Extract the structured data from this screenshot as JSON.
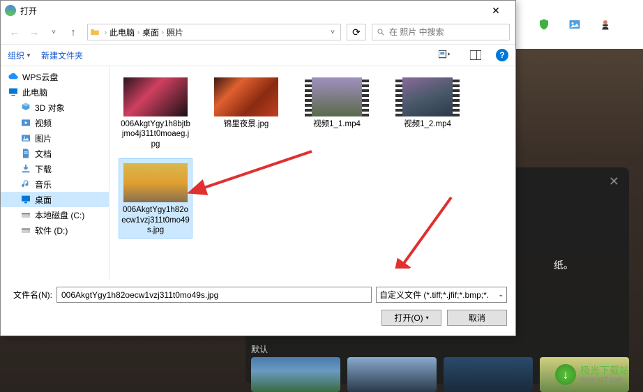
{
  "dialog": {
    "title": "打开",
    "breadcrumb": [
      "此电脑",
      "桌面",
      "照片"
    ],
    "search_placeholder": "在 照片 中搜索",
    "toolbar": {
      "organize": "组织",
      "new_folder": "新建文件夹"
    },
    "sidebar": [
      {
        "label": "WPS云盘",
        "icon": "cloud",
        "color": "#1e90ff"
      },
      {
        "label": "此电脑",
        "icon": "pc",
        "color": "#0078d7"
      },
      {
        "label": "3D 对象",
        "icon": "3d",
        "color": "#50a0e0",
        "indent": true
      },
      {
        "label": "视频",
        "icon": "video",
        "color": "#5090d0",
        "indent": true
      },
      {
        "label": "图片",
        "icon": "pictures",
        "color": "#5090d0",
        "indent": true
      },
      {
        "label": "文档",
        "icon": "docs",
        "color": "#5090d0",
        "indent": true
      },
      {
        "label": "下载",
        "icon": "downloads",
        "color": "#5090d0",
        "indent": true
      },
      {
        "label": "音乐",
        "icon": "music",
        "color": "#5090d0",
        "indent": true
      },
      {
        "label": "桌面",
        "icon": "desktop",
        "color": "#0078d7",
        "indent": true,
        "selected": true
      },
      {
        "label": "本地磁盘 (C:)",
        "icon": "drive",
        "color": "#888",
        "indent": true
      },
      {
        "label": "软件 (D:)",
        "icon": "drive",
        "color": "#888",
        "indent": true
      }
    ],
    "files": [
      {
        "name": "006AkgtYgy1h8bjtbjmo4j311t0moaeg.jpg",
        "thumb": "img1"
      },
      {
        "name": "锦里夜景.jpg",
        "thumb": "img2"
      },
      {
        "name": "视频1_1.mp4",
        "thumb": "vid3",
        "video": true
      },
      {
        "name": "视频1_2.mp4",
        "thumb": "vid4",
        "video": true
      },
      {
        "name": "006AkgtYgy1h82oecw1vzj311t0mo49s.jpg",
        "thumb": "img5",
        "selected": true
      }
    ],
    "filename_label": "文件名(N):",
    "filename_value": "006AkgtYgy1h82oecw1vzj311t0mo49s.jpg",
    "filter": "自定义文件 (*.tiff;*.jfif;*.bmp;*.",
    "open_btn": "打开(O)",
    "cancel_btn": "取消"
  },
  "bg": {
    "text_fragment": "纸。",
    "default_label": "默认",
    "brand_name": "极光下载站",
    "brand_url": "www.xz7.com"
  }
}
